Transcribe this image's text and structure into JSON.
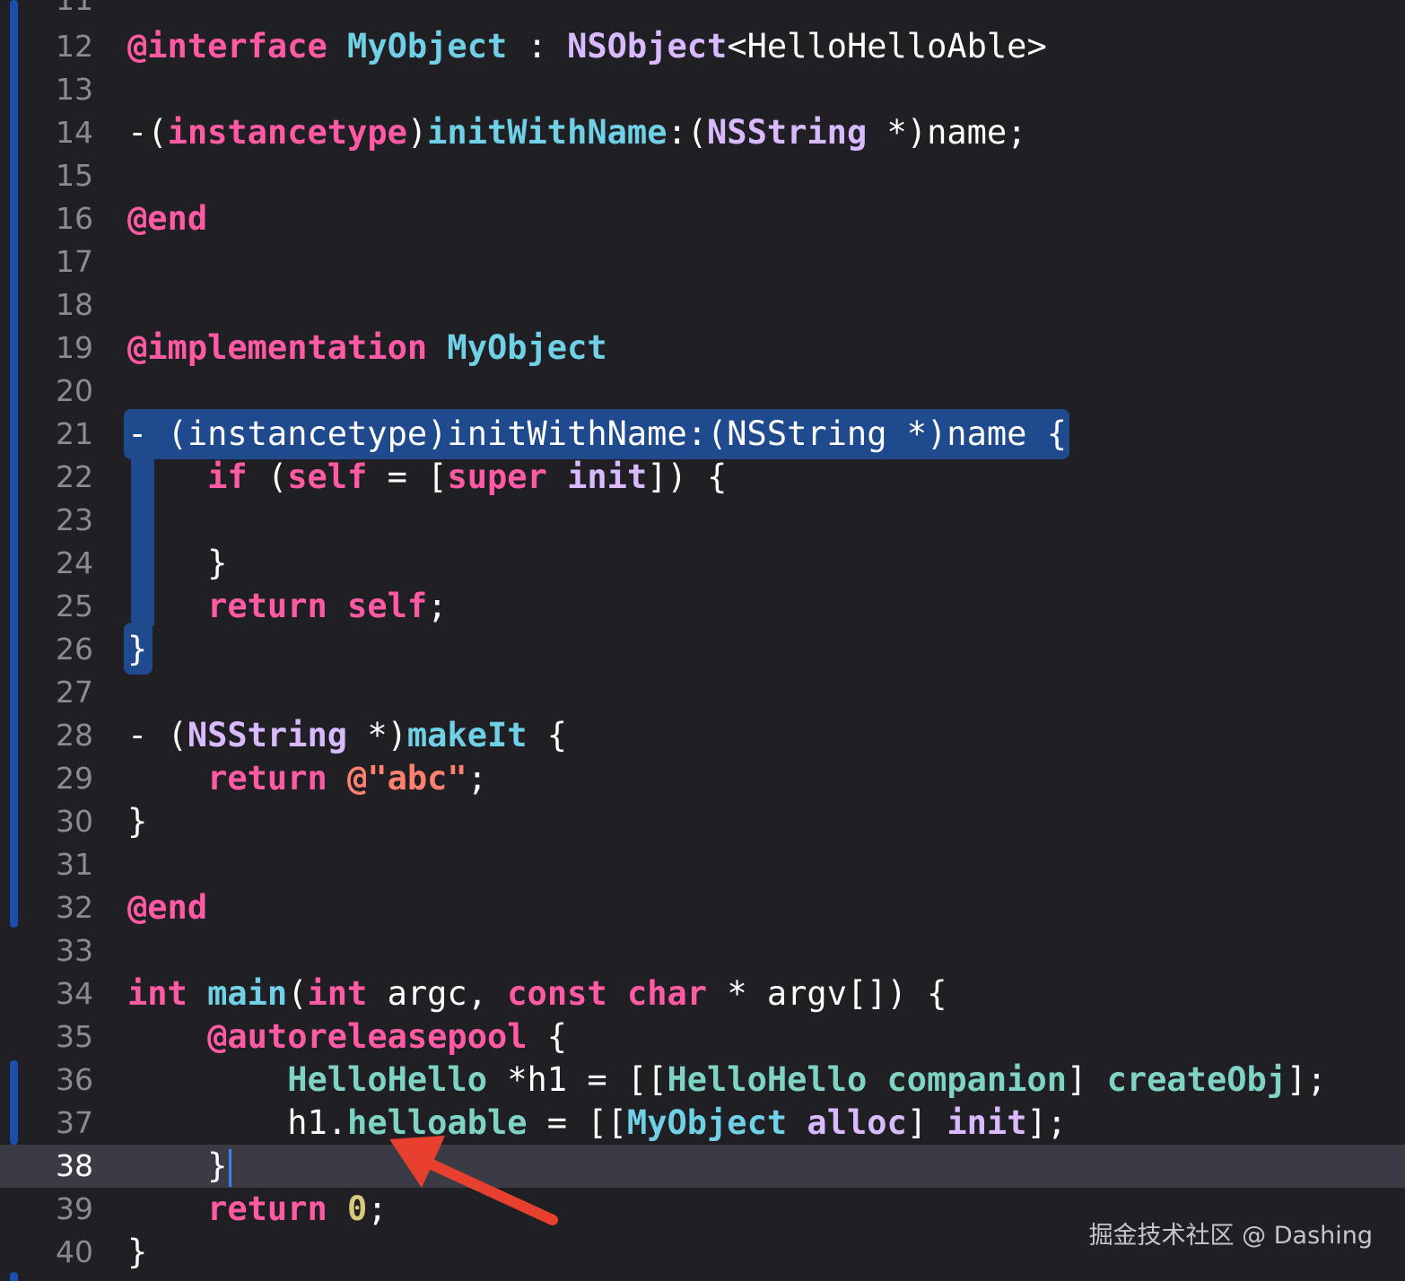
{
  "colors": {
    "background": "#1f1f24",
    "current_line": "#3a3b44",
    "selection": "#1f4a8e",
    "line_number": "#8a8a93",
    "keyword": "#ff5aa3",
    "type": "#d9baff",
    "class_name": "#6fd0e6",
    "method": "#7fd3c4",
    "string": "#ff8170",
    "number": "#d9c97c",
    "plain": "#ffffff",
    "arrow": "#e8402f",
    "caret": "#3b82f6"
  },
  "editor": {
    "partial_top_line": "11",
    "current_line": 38,
    "lines": [
      {
        "n": "12",
        "tokens": [
          {
            "t": "@interface",
            "c": "keyword"
          },
          {
            "t": " "
          },
          {
            "t": "MyObject",
            "c": "class_name"
          },
          {
            "t": " : "
          },
          {
            "t": "NSObject",
            "c": "type"
          },
          {
            "t": "<HelloHelloAble>"
          }
        ]
      },
      {
        "n": "13",
        "tokens": []
      },
      {
        "n": "14",
        "tokens": [
          {
            "t": "-("
          },
          {
            "t": "instancetype",
            "c": "keyword"
          },
          {
            "t": ")"
          },
          {
            "t": "initWithName",
            "c": "class_name"
          },
          {
            "t": ":("
          },
          {
            "t": "NSString",
            "c": "type"
          },
          {
            "t": " *)name;"
          }
        ]
      },
      {
        "n": "15",
        "tokens": []
      },
      {
        "n": "16",
        "tokens": [
          {
            "t": "@end",
            "c": "keyword"
          }
        ]
      },
      {
        "n": "17",
        "tokens": []
      },
      {
        "n": "18",
        "tokens": []
      },
      {
        "n": "19",
        "tokens": [
          {
            "t": "@implementation",
            "c": "keyword"
          },
          {
            "t": " "
          },
          {
            "t": "MyObject",
            "c": "class_name"
          }
        ]
      },
      {
        "n": "20",
        "tokens": []
      },
      {
        "n": "21",
        "tokens": [
          {
            "t": "- (instancetype)initWithName:(NSString *)name {"
          }
        ]
      },
      {
        "n": "22",
        "tokens": [
          {
            "t": "    "
          },
          {
            "t": "if",
            "c": "keyword"
          },
          {
            "t": " ("
          },
          {
            "t": "self",
            "c": "keyword"
          },
          {
            "t": " = ["
          },
          {
            "t": "super",
            "c": "keyword"
          },
          {
            "t": " "
          },
          {
            "t": "init",
            "c": "type"
          },
          {
            "t": "]) {"
          }
        ]
      },
      {
        "n": "23",
        "tokens": []
      },
      {
        "n": "24",
        "tokens": [
          {
            "t": "    }"
          }
        ]
      },
      {
        "n": "25",
        "tokens": [
          {
            "t": "    "
          },
          {
            "t": "return",
            "c": "keyword"
          },
          {
            "t": " "
          },
          {
            "t": "self",
            "c": "keyword"
          },
          {
            "t": ";"
          }
        ]
      },
      {
        "n": "26",
        "tokens": [
          {
            "t": "}"
          }
        ]
      },
      {
        "n": "27",
        "tokens": []
      },
      {
        "n": "28",
        "tokens": [
          {
            "t": "- ("
          },
          {
            "t": "NSString",
            "c": "type"
          },
          {
            "t": " *)"
          },
          {
            "t": "makeIt",
            "c": "class_name"
          },
          {
            "t": " {"
          }
        ]
      },
      {
        "n": "29",
        "tokens": [
          {
            "t": "    "
          },
          {
            "t": "return",
            "c": "keyword"
          },
          {
            "t": " "
          },
          {
            "t": "@\"abc\"",
            "c": "string"
          },
          {
            "t": ";"
          }
        ]
      },
      {
        "n": "30",
        "tokens": [
          {
            "t": "}"
          }
        ]
      },
      {
        "n": "31",
        "tokens": []
      },
      {
        "n": "32",
        "tokens": [
          {
            "t": "@end",
            "c": "keyword"
          }
        ]
      },
      {
        "n": "33",
        "tokens": []
      },
      {
        "n": "34",
        "tokens": [
          {
            "t": "int",
            "c": "keyword"
          },
          {
            "t": " "
          },
          {
            "t": "main",
            "c": "class_name"
          },
          {
            "t": "("
          },
          {
            "t": "int",
            "c": "keyword"
          },
          {
            "t": " argc, "
          },
          {
            "t": "const",
            "c": "keyword"
          },
          {
            "t": " "
          },
          {
            "t": "char",
            "c": "keyword"
          },
          {
            "t": " * argv[]) {"
          }
        ]
      },
      {
        "n": "35",
        "tokens": [
          {
            "t": "    "
          },
          {
            "t": "@autoreleasepool",
            "c": "keyword"
          },
          {
            "t": " {"
          }
        ]
      },
      {
        "n": "36",
        "tokens": [
          {
            "t": "        "
          },
          {
            "t": "HelloHello",
            "c": "method"
          },
          {
            "t": " *h1 = [["
          },
          {
            "t": "HelloHello",
            "c": "method"
          },
          {
            "t": " "
          },
          {
            "t": "companion",
            "c": "method"
          },
          {
            "t": "] "
          },
          {
            "t": "createObj",
            "c": "method"
          },
          {
            "t": "];"
          }
        ]
      },
      {
        "n": "37",
        "tokens": [
          {
            "t": "        h1."
          },
          {
            "t": "helloable",
            "c": "method"
          },
          {
            "t": " = [["
          },
          {
            "t": "MyObject",
            "c": "class_name"
          },
          {
            "t": " "
          },
          {
            "t": "alloc",
            "c": "type"
          },
          {
            "t": "] "
          },
          {
            "t": "init",
            "c": "type"
          },
          {
            "t": "];"
          }
        ]
      },
      {
        "n": "38",
        "tokens": [
          {
            "t": "    }"
          }
        ]
      },
      {
        "n": "39",
        "tokens": [
          {
            "t": "    "
          },
          {
            "t": "return",
            "c": "keyword"
          },
          {
            "t": " "
          },
          {
            "t": "0",
            "c": "number"
          },
          {
            "t": ";"
          }
        ]
      },
      {
        "n": "40",
        "tokens": [
          {
            "t": "}"
          }
        ]
      }
    ]
  },
  "watermark": "掘金技术社区 @ Dashing"
}
